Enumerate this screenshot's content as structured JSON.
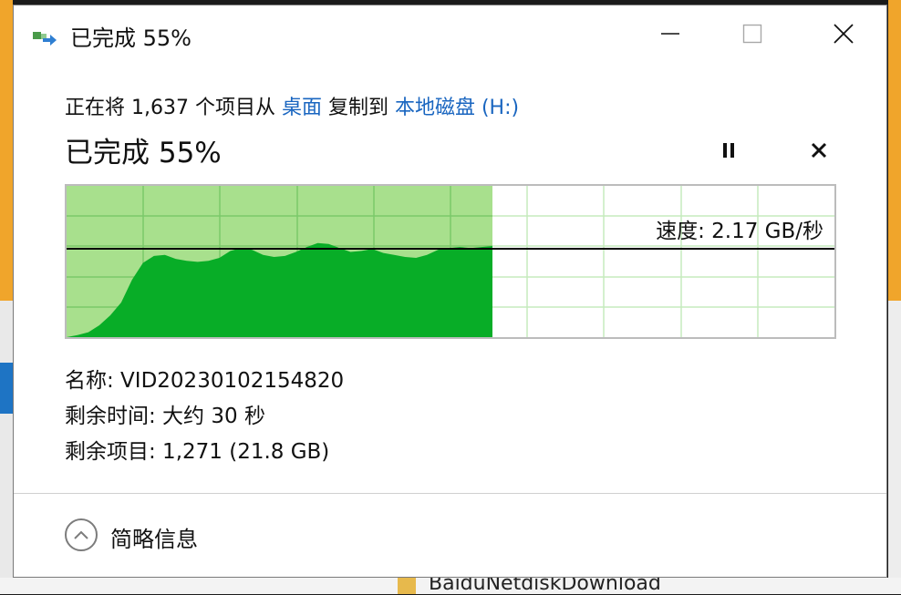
{
  "window": {
    "title": "已完成 55%",
    "controls": {
      "minimize": "minimize-icon",
      "maximize": "maximize-icon",
      "close": "close-icon"
    }
  },
  "copy": {
    "desc_prefix": "正在将 1,637 个项目从 ",
    "source": "桌面",
    "desc_middle": " 复制到 ",
    "destination": "本地磁盘 (H:)",
    "percent_label": "已完成 55%",
    "progress": 0.55
  },
  "graph": {
    "speed_label": "速度: 2.17 GB/秒",
    "colors": {
      "completed": "#a8e08d",
      "speed_area": "#08ad27",
      "grid": "#7bc96a",
      "grid_remaining": "#c5ebbd",
      "line": "#000000"
    },
    "speed_profile": [
      0,
      0.02,
      0.05,
      0.12,
      0.22,
      0.35,
      0.58,
      0.75,
      0.82,
      0.83,
      0.79,
      0.77,
      0.76,
      0.77,
      0.8,
      0.87,
      0.9,
      0.88,
      0.83,
      0.81,
      0.82,
      0.86,
      0.91,
      0.95,
      0.94,
      0.9,
      0.86,
      0.87,
      0.89,
      0.85,
      0.83,
      0.81,
      0.8,
      0.83,
      0.88,
      0.9,
      0.91,
      0.9,
      0.91,
      0.92
    ]
  },
  "details": {
    "name": "名称: VID20230102154820",
    "time_remaining": "剩余时间: 大约 30 秒",
    "items_remaining": "剩余项目: 1,271 (21.8 GB)"
  },
  "footer": {
    "collapse_label": "简略信息",
    "collapse_icon": "chevron-up-icon"
  },
  "background": {
    "folder_name": "BaiduNetdiskDownload"
  }
}
